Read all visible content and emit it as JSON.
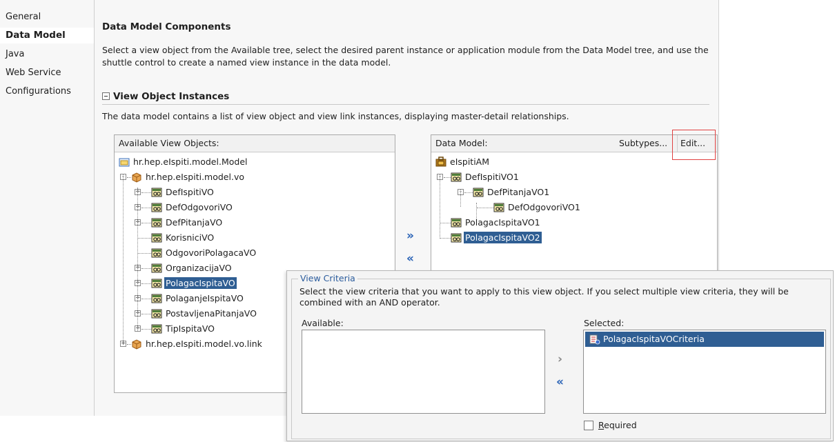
{
  "nav": {
    "items": [
      {
        "label": "General",
        "active": false
      },
      {
        "label": "Data Model",
        "active": true
      },
      {
        "label": "Java",
        "active": false
      },
      {
        "label": "Web Service",
        "active": false
      },
      {
        "label": "Configurations",
        "active": false
      }
    ]
  },
  "main": {
    "title": "Data Model Components",
    "description": "Select a view object from the Available tree, select the desired parent instance or application module from the Data Model tree, and use the shuttle control to create a named view instance in the data model.",
    "section_title": "View Object Instances",
    "section_description": "The data model contains a list of view object and view link instances, displaying master-detail relationships."
  },
  "available": {
    "header": "Available View Objects:",
    "tree": [
      {
        "label": "hr.hep.eIspiti.model.Model",
        "icon": "package-folder-icon"
      },
      {
        "label": "hr.hep.eIspiti.model.vo",
        "icon": "package-icon"
      },
      {
        "label": "DefIspitiVO",
        "icon": "view-object-icon"
      },
      {
        "label": "DefOdgovoriVO",
        "icon": "view-object-icon"
      },
      {
        "label": "DefPitanjaVO",
        "icon": "view-object-icon"
      },
      {
        "label": "KorisniciVO",
        "icon": "view-object-icon"
      },
      {
        "label": "OdgovoriPolagacaVO",
        "icon": "view-object-icon"
      },
      {
        "label": "OrganizacijaVO",
        "icon": "view-object-icon"
      },
      {
        "label": "PolagacIspitaVO",
        "icon": "view-object-icon",
        "selected": true
      },
      {
        "label": "PolaganjeIspitaVO",
        "icon": "view-object-icon"
      },
      {
        "label": "PostavljenaPitanjaVO",
        "icon": "view-object-icon"
      },
      {
        "label": "TipIspitaVO",
        "icon": "view-object-icon"
      },
      {
        "label": "hr.hep.eIspiti.model.vo.link",
        "icon": "package-icon"
      }
    ]
  },
  "shuttle": {
    "add": "»",
    "remove": "«"
  },
  "datamodel": {
    "header": "Data Model:",
    "subtypes_label": "Subtypes...",
    "edit_label": "Edit...",
    "tree": [
      {
        "label": "eIspitiAM",
        "icon": "application-module-icon"
      },
      {
        "label": "DefIspitiVO1",
        "icon": "view-object-icon"
      },
      {
        "label": "DefPitanjaVO1",
        "icon": "view-object-icon"
      },
      {
        "label": "DefOdgovoriVO1",
        "icon": "view-object-icon"
      },
      {
        "label": "PolagacIspitaVO1",
        "icon": "view-object-icon"
      },
      {
        "label": "PolagacIspitaVO2",
        "icon": "view-object-icon",
        "selected": true
      }
    ]
  },
  "view_criteria": {
    "legend": "View Criteria",
    "description": "Select the view criteria that you want to apply to this view object. If you select multiple view criteria, they will be combined with an AND operator.",
    "available_label": "Available:",
    "selected_label": "Selected:",
    "selected_items": [
      "PolagacIspitaVOCriteria"
    ],
    "required_label": "Required",
    "required_checked": false,
    "add_button": "›",
    "remove_button": "«"
  },
  "colors": {
    "selection": "#2f5e93",
    "accent_blue": "#2a63b6",
    "highlight_red": "#e04040"
  }
}
